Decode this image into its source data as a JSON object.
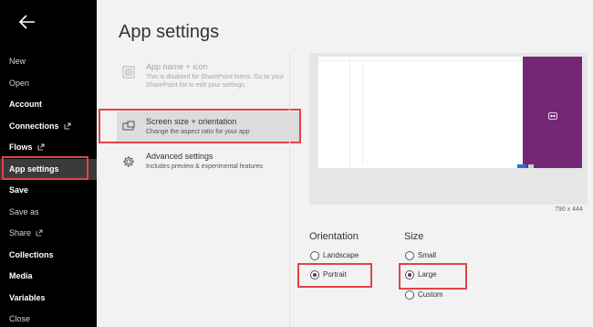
{
  "sidebar": {
    "back_icon": "arrow-left-icon",
    "items": [
      {
        "label": "New"
      },
      {
        "label": "Open"
      },
      {
        "label": "Account"
      },
      {
        "label": "Connections"
      },
      {
        "label": "Flows"
      },
      {
        "label": "App settings"
      },
      {
        "label": "Save"
      },
      {
        "label": "Save as"
      },
      {
        "label": "Share"
      },
      {
        "label": "Collections"
      },
      {
        "label": "Media"
      },
      {
        "label": "Variables"
      },
      {
        "label": "Close"
      }
    ]
  },
  "main": {
    "title": "App settings",
    "menu": [
      {
        "title": "App name + icon",
        "subtitle": "This is disabled for SharePoint forms. Go to your SharePoint list to edit your settings.",
        "icon": "app-icon"
      },
      {
        "title": "Screen size + orientation",
        "subtitle": "Change the aspect ratio for your app",
        "icon": "screen-size-icon"
      },
      {
        "title": "Advanced settings",
        "subtitle": "Includes preview & experimental features",
        "icon": "gear-icon"
      }
    ],
    "preview_dimensions": "790 x 444",
    "orientation": {
      "heading": "Orientation",
      "options": [
        "Landscape",
        "Portrait"
      ],
      "selected": "Portrait"
    },
    "size": {
      "heading": "Size",
      "options": [
        "Small",
        "Large",
        "Custom"
      ],
      "selected": "Large"
    }
  },
  "colors": {
    "accent": "#742774",
    "highlight": "#e04444",
    "sidebar_bg": "#000000"
  }
}
